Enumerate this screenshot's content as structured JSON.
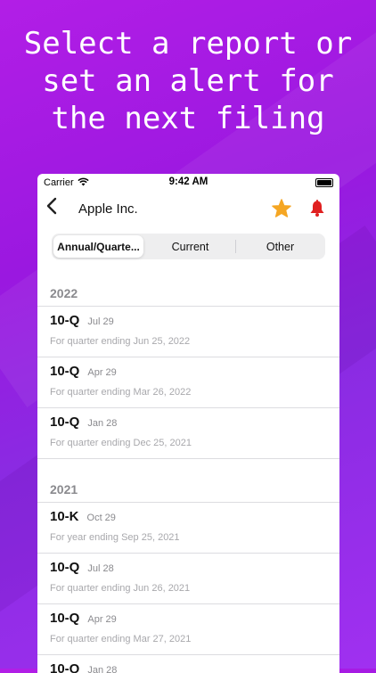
{
  "headline": {
    "line1": "Select a report or",
    "line2": "set an alert for",
    "line3": "the next filing"
  },
  "status_bar": {
    "carrier": "Carrier",
    "time": "9:42 AM"
  },
  "navbar": {
    "back_icon": "chevron-left-icon",
    "title": "Apple Inc.",
    "favorite_icon": "star-icon",
    "alert_icon": "bell-icon",
    "star_color": "#f5a623",
    "bell_color": "#e02020"
  },
  "segments": [
    {
      "label": "Annual/Quarte...",
      "selected": true
    },
    {
      "label": "Current",
      "selected": false
    },
    {
      "label": "Other",
      "selected": false
    }
  ],
  "sections": [
    {
      "year": "2022",
      "filings": [
        {
          "form": "10-Q",
          "date": "Jul 29",
          "description": "For quarter ending Jun 25, 2022"
        },
        {
          "form": "10-Q",
          "date": "Apr 29",
          "description": "For quarter ending Mar 26, 2022"
        },
        {
          "form": "10-Q",
          "date": "Jan 28",
          "description": "For quarter ending Dec 25, 2021"
        }
      ]
    },
    {
      "year": "2021",
      "filings": [
        {
          "form": "10-K",
          "date": "Oct 29",
          "description": "For year ending Sep 25, 2021"
        },
        {
          "form": "10-Q",
          "date": "Jul 28",
          "description": "For quarter ending Jun 26, 2021"
        },
        {
          "form": "10-Q",
          "date": "Apr 29",
          "description": "For quarter ending Mar 27, 2021"
        },
        {
          "form": "10-Q",
          "date": "Jan 28",
          "description": ""
        }
      ]
    }
  ]
}
